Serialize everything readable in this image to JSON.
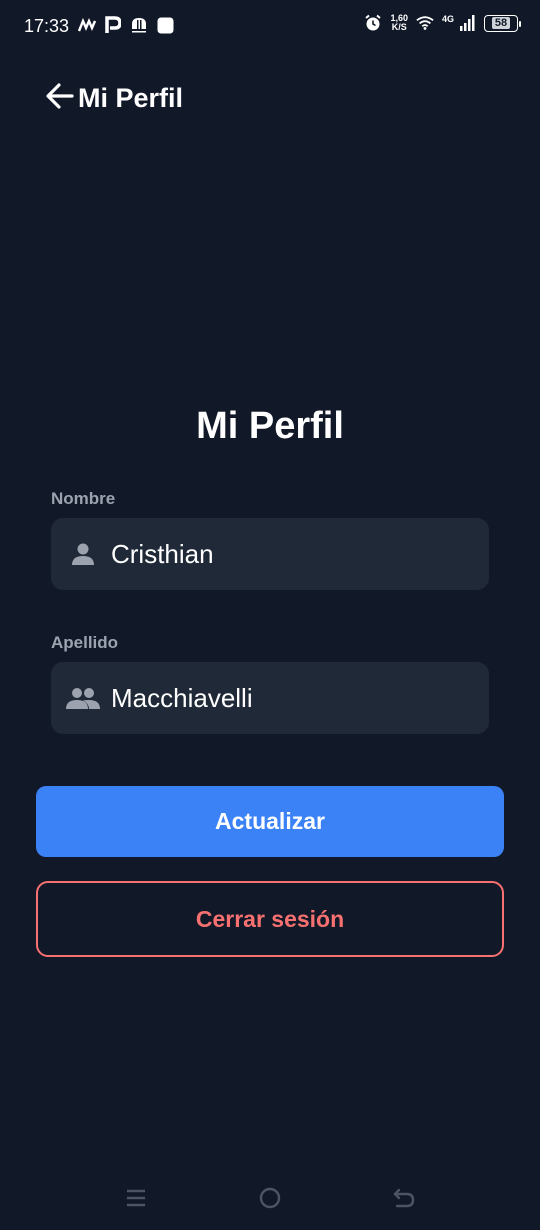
{
  "status_bar": {
    "time": "17:33",
    "net_speed_value": "1,60",
    "net_speed_unit": "K/S",
    "net_type": "4G",
    "battery": "58"
  },
  "app_bar": {
    "title": "Mi Perfil"
  },
  "form": {
    "title": "Mi Perfil",
    "first_name": {
      "label": "Nombre",
      "value": "Cristhian",
      "icon": "person-icon"
    },
    "last_name": {
      "label": "Apellido",
      "value": "Macchiavelli",
      "icon": "people-icon"
    },
    "update_button": "Actualizar",
    "logout_button": "Cerrar sesión"
  },
  "colors": {
    "background": "#111827",
    "field_bg": "#1f2937",
    "primary": "#3b82f6",
    "danger": "#f87171",
    "label": "#9ca3af"
  }
}
